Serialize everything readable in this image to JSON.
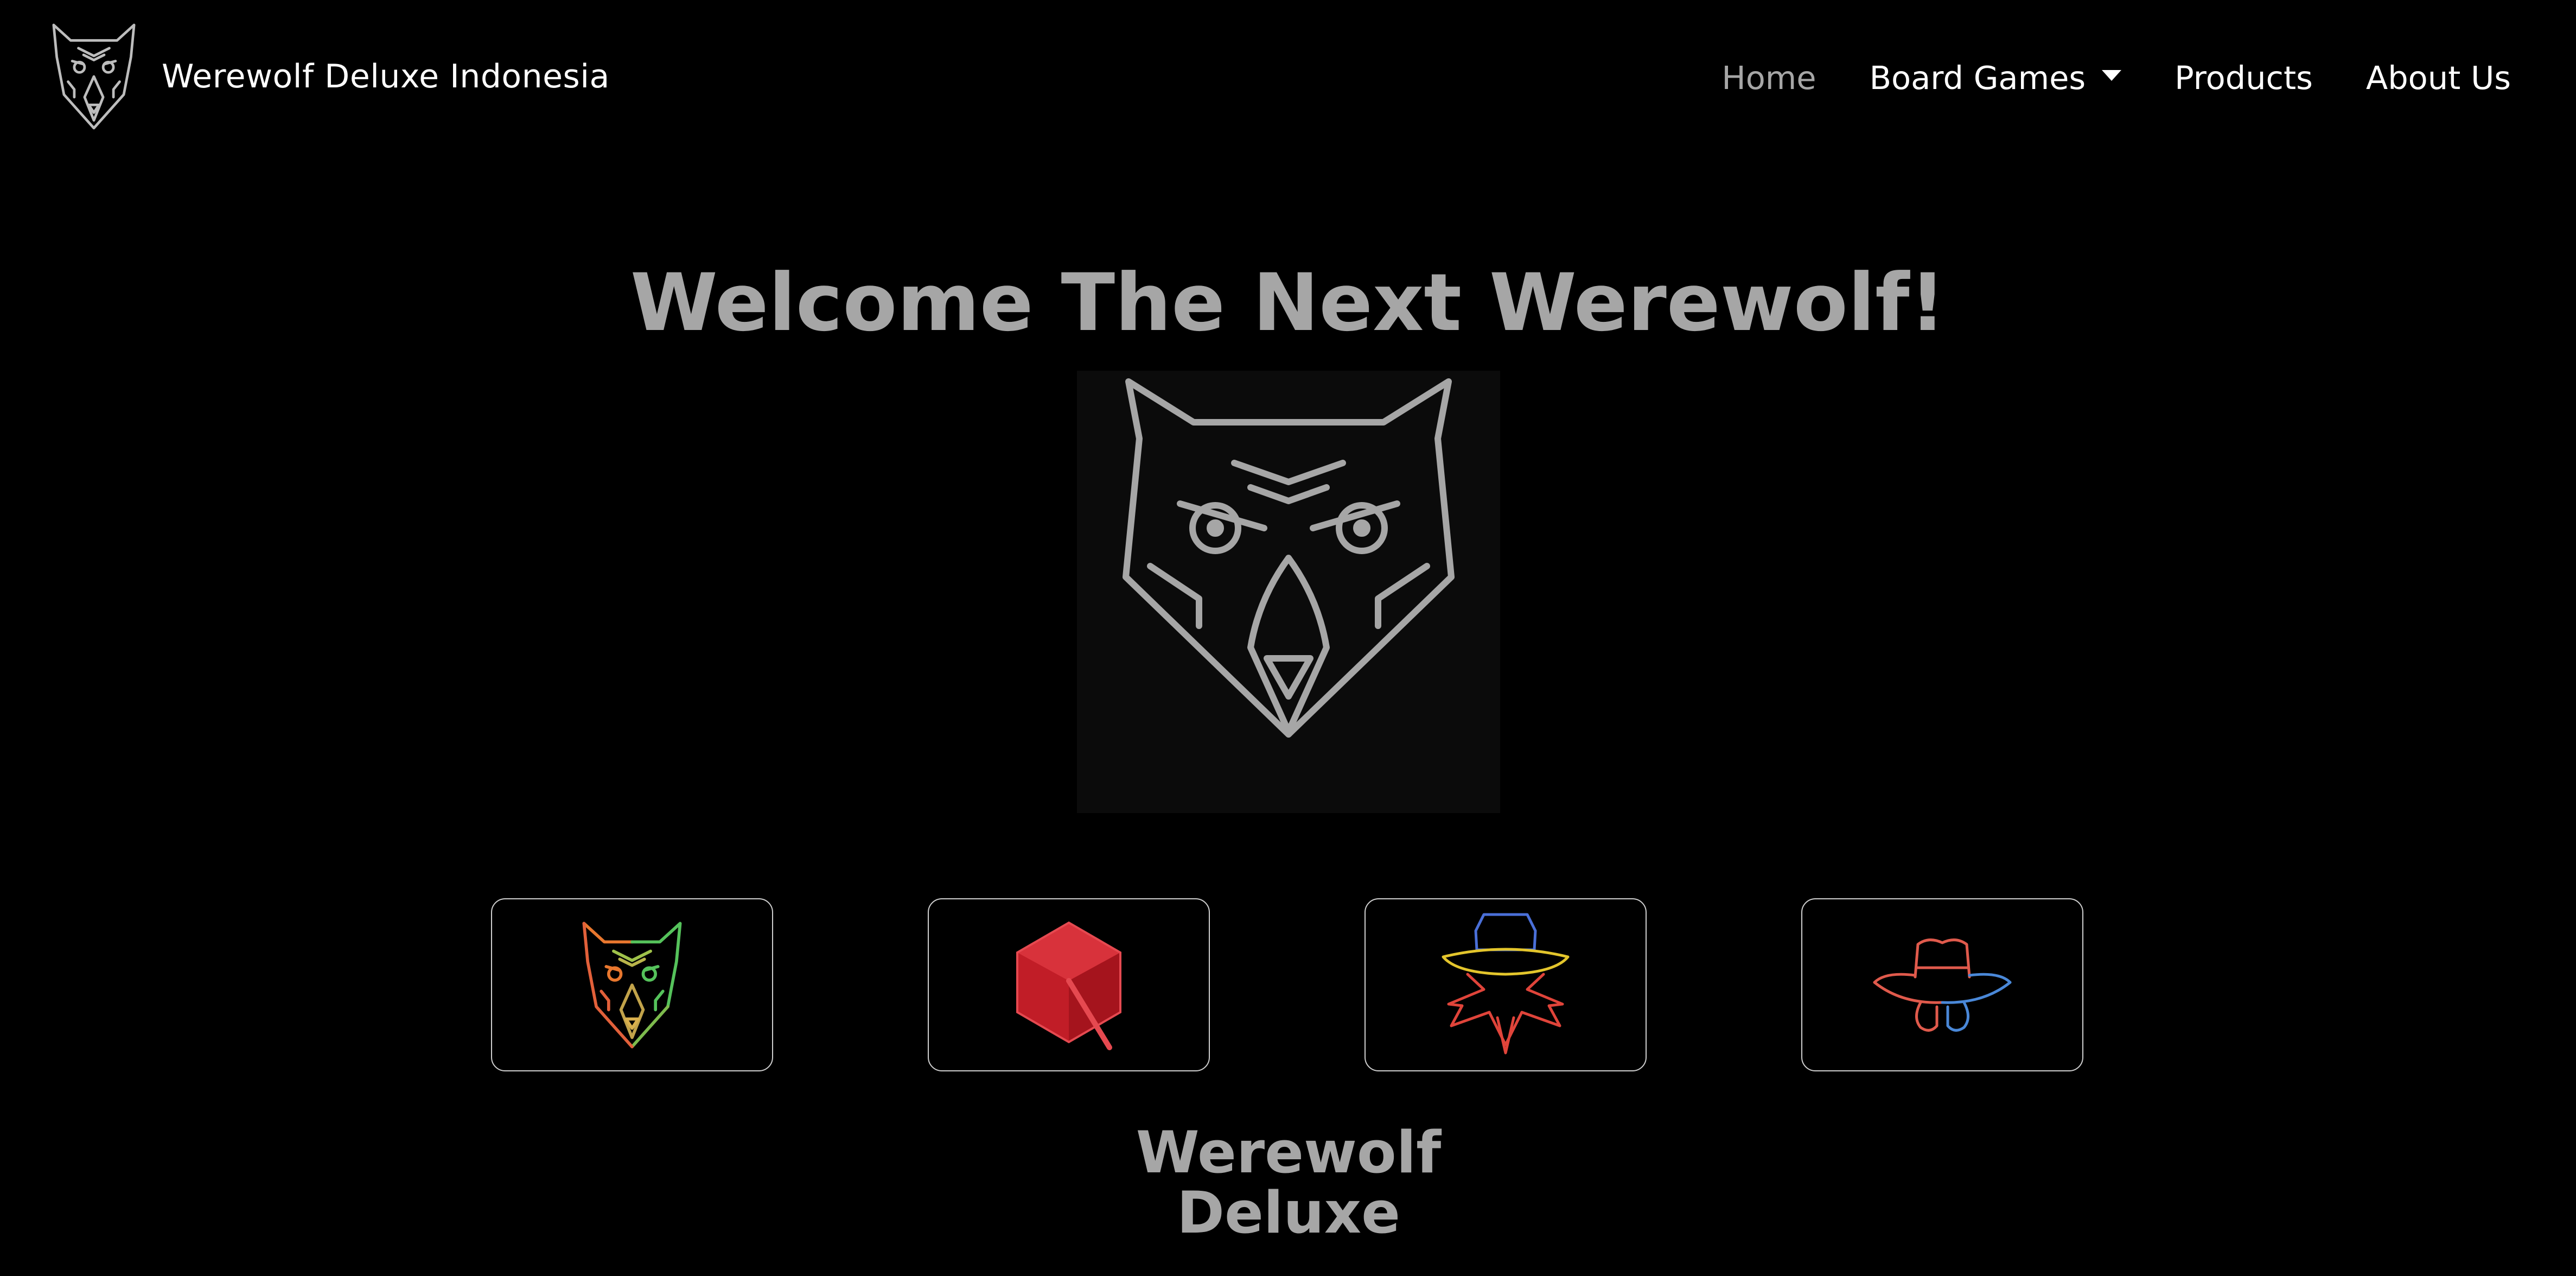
{
  "brand": {
    "name": "Werewolf Deluxe Indonesia"
  },
  "nav": {
    "home": "Home",
    "board_games": "Board Games",
    "products": "Products",
    "about_us": "About Us"
  },
  "hero": {
    "title": "Welcome The Next Werewolf!",
    "caption": "Werewolf Deluxe"
  },
  "cards": [
    {
      "icon": "werewolf-icon"
    },
    {
      "icon": "red-hexagon-icon"
    },
    {
      "icon": "spy-icon"
    },
    {
      "icon": "detective-hat-icon"
    }
  ],
  "colors": {
    "background": "#000000",
    "hero_text": "#a6a6a6",
    "nav_active": "#a6a6a6",
    "card_border": "#cfcfcf"
  }
}
